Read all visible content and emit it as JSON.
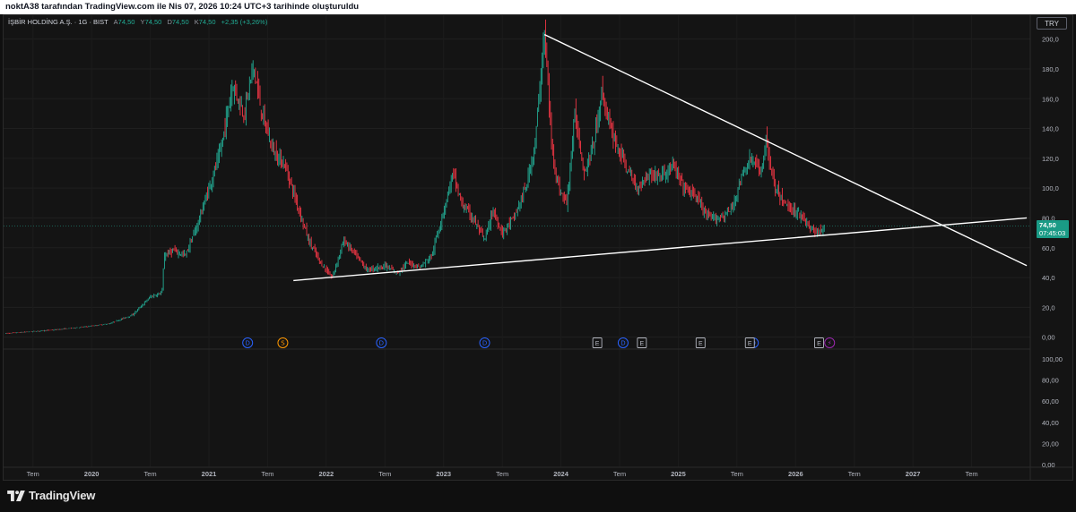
{
  "header": {
    "caption": "noktA38 tarafından TradingView.com ile Nis 07, 2026 10:24 UTC+3 tarihinde oluşturuldu"
  },
  "legend": {
    "title": "İŞBİR HOLDİNG A.Ş. · 1G · BIST",
    "open_label": "A",
    "open": "74,50",
    "high_label": "Y",
    "high": "74,50",
    "low_label": "D",
    "low": "74,50",
    "close_label": "K",
    "close": "74,50",
    "change": "+2,35 (+3,26%)"
  },
  "currency": "TRY",
  "price_badge": {
    "price": "74,50",
    "countdown": "07:45:03"
  },
  "brand": {
    "name": "TradingView"
  },
  "colors": {
    "up": "#22ab94",
    "down": "#f23645",
    "line": "#ffffff",
    "badge": "#1a9b86",
    "dividend": "#2962ff",
    "split": "#ff9800",
    "earnings": "#b2b5be",
    "future": "#9c27b0"
  },
  "chart_data": {
    "type": "candlestick",
    "symbol": "İŞBİR HOLDİNG A.Ş.",
    "interval": "1G",
    "exchange": "BIST",
    "last_price": 74.5,
    "price_axis": {
      "ticks": [
        "200,0",
        "180,0",
        "160,0",
        "140,0",
        "120,0",
        "100,0",
        "80,0",
        "60,0",
        "40,0",
        "20,0",
        "0,00"
      ],
      "values": [
        200,
        180,
        160,
        140,
        120,
        100,
        80,
        60,
        40,
        20,
        0
      ],
      "range": [
        -8,
        216
      ]
    },
    "lower_axis": {
      "ticks": [
        "100,00",
        "80,00",
        "60,00",
        "40,00",
        "20,00",
        "0,00"
      ],
      "values": [
        100,
        80,
        60,
        40,
        20,
        0
      ]
    },
    "time_axis": [
      "Tem",
      "2020",
      "Tem",
      "2021",
      "Tem",
      "2022",
      "Tem",
      "2023",
      "Tem",
      "2024",
      "Tem",
      "2025",
      "Tem",
      "2026",
      "Tem",
      "2027",
      "Tem"
    ],
    "time_axis_values": [
      2019.5,
      2020,
      2020.5,
      2021,
      2021.5,
      2022,
      2022.5,
      2023,
      2023.5,
      2024,
      2024.5,
      2025,
      2025.5,
      2026,
      2026.5,
      2027,
      2027.5
    ],
    "time_range": [
      2019.25,
      2028.0
    ],
    "price_path": [
      [
        2019.27,
        2.5
      ],
      [
        2019.45,
        3.5
      ],
      [
        2019.7,
        5
      ],
      [
        2019.95,
        7
      ],
      [
        2020.15,
        9
      ],
      [
        2020.35,
        15
      ],
      [
        2020.5,
        27
      ],
      [
        2020.6,
        30
      ],
      [
        2020.62,
        55
      ],
      [
        2020.7,
        58
      ],
      [
        2020.8,
        55
      ],
      [
        2020.9,
        75
      ],
      [
        2021.0,
        100
      ],
      [
        2021.1,
        125
      ],
      [
        2021.2,
        170
      ],
      [
        2021.3,
        150
      ],
      [
        2021.38,
        182
      ],
      [
        2021.45,
        150
      ],
      [
        2021.55,
        125
      ],
      [
        2021.65,
        115
      ],
      [
        2021.75,
        90
      ],
      [
        2021.85,
        65
      ],
      [
        2021.95,
        50
      ],
      [
        2022.05,
        40
      ],
      [
        2022.15,
        65
      ],
      [
        2022.25,
        55
      ],
      [
        2022.35,
        45
      ],
      [
        2022.5,
        48
      ],
      [
        2022.6,
        43
      ],
      [
        2022.7,
        50
      ],
      [
        2022.8,
        47
      ],
      [
        2022.9,
        55
      ],
      [
        2023.0,
        85
      ],
      [
        2023.08,
        110
      ],
      [
        2023.15,
        90
      ],
      [
        2023.25,
        80
      ],
      [
        2023.35,
        65
      ],
      [
        2023.42,
        85
      ],
      [
        2023.5,
        70
      ],
      [
        2023.6,
        80
      ],
      [
        2023.7,
        100
      ],
      [
        2023.78,
        130
      ],
      [
        2023.86,
        205
      ],
      [
        2023.92,
        130
      ],
      [
        2023.98,
        100
      ],
      [
        2024.05,
        90
      ],
      [
        2024.12,
        150
      ],
      [
        2024.2,
        110
      ],
      [
        2024.28,
        130
      ],
      [
        2024.35,
        165
      ],
      [
        2024.42,
        140
      ],
      [
        2024.5,
        125
      ],
      [
        2024.58,
        110
      ],
      [
        2024.65,
        100
      ],
      [
        2024.75,
        110
      ],
      [
        2024.85,
        108
      ],
      [
        2024.95,
        115
      ],
      [
        2025.05,
        100
      ],
      [
        2025.15,
        95
      ],
      [
        2025.25,
        80
      ],
      [
        2025.35,
        80
      ],
      [
        2025.45,
        85
      ],
      [
        2025.55,
        110
      ],
      [
        2025.62,
        120
      ],
      [
        2025.7,
        110
      ],
      [
        2025.75,
        132
      ],
      [
        2025.82,
        100
      ],
      [
        2025.9,
        90
      ],
      [
        2025.98,
        85
      ],
      [
        2026.05,
        82
      ],
      [
        2026.12,
        73
      ],
      [
        2026.2,
        70
      ],
      [
        2026.25,
        74.5
      ]
    ],
    "trendlines": [
      {
        "from": [
          2021.72,
          38
        ],
        "to": [
          2027.97,
          80
        ]
      },
      {
        "from": [
          2023.86,
          203
        ],
        "to": [
          2027.97,
          48
        ]
      }
    ],
    "events": [
      {
        "type": "dividend",
        "label": "D",
        "x": 2021.33
      },
      {
        "type": "split",
        "label": "S",
        "x": 2021.63
      },
      {
        "type": "dividend",
        "label": "D",
        "x": 2022.47
      },
      {
        "type": "dividend",
        "label": "D",
        "x": 2023.35
      },
      {
        "type": "earnings",
        "label": "E",
        "x": 2024.31
      },
      {
        "type": "dividend",
        "label": "D",
        "x": 2024.53
      },
      {
        "type": "earnings",
        "label": "E",
        "x": 2024.69
      },
      {
        "type": "earnings",
        "label": "E",
        "x": 2025.19
      },
      {
        "type": "dividend",
        "label": "D",
        "x": 2025.64
      },
      {
        "type": "earnings",
        "label": "E",
        "x": 2025.61
      },
      {
        "type": "earnings",
        "label": "E",
        "x": 2026.2
      },
      {
        "type": "future",
        "label": "⚡",
        "x": 2026.29
      }
    ]
  }
}
